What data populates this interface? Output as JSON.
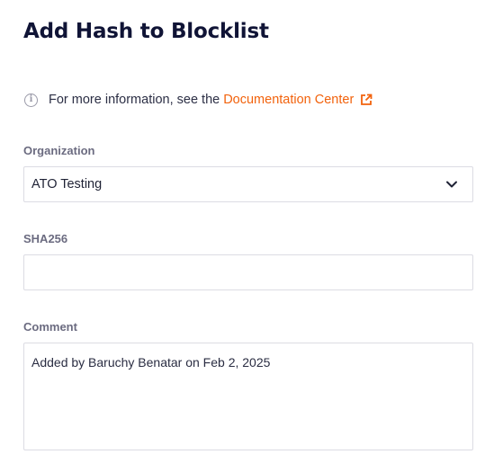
{
  "form": {
    "title": "Add Hash to Blocklist",
    "info": {
      "icon": "info-circle-icon",
      "text": "For more information, see the",
      "link_label": "Documentation Center",
      "link_icon": "external-link-icon",
      "link_color": "#f2620c"
    },
    "organization": {
      "label": "Organization",
      "value": "ATO Testing",
      "icon": "chevron-down-icon"
    },
    "sha256": {
      "label": "SHA256",
      "value": ""
    },
    "comment": {
      "label": "Comment",
      "value": "Added by Baruchy Benatar on Feb 2, 2025"
    }
  }
}
